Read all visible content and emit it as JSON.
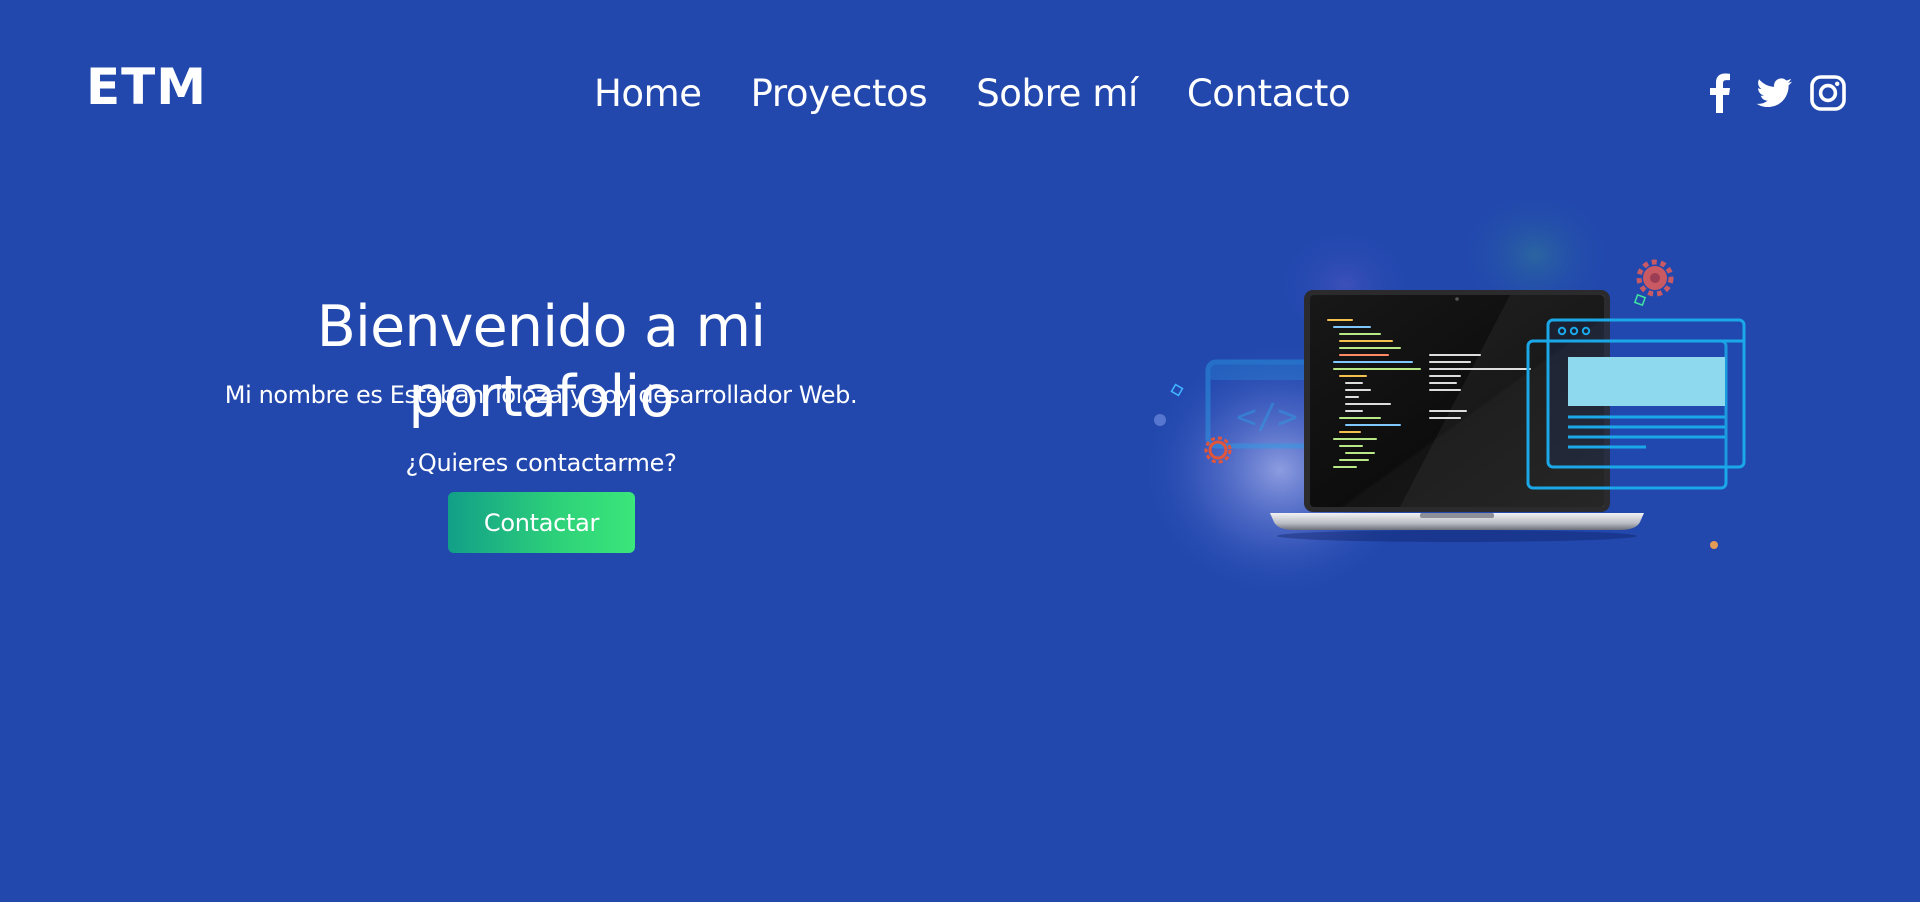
{
  "header": {
    "logo": "ETM",
    "nav": [
      {
        "label": "Home"
      },
      {
        "label": "Proyectos"
      },
      {
        "label": "Sobre mí"
      },
      {
        "label": "Contacto"
      }
    ],
    "social": [
      {
        "icon": "facebook-icon"
      },
      {
        "icon": "twitter-icon"
      },
      {
        "icon": "instagram-icon"
      }
    ]
  },
  "hero": {
    "title": "Bienvenido a mi portafolio",
    "subtitle": "Mi nombre es Esteban Toloza y soy desarrollador Web.",
    "question": "¿Quieres contactarme?",
    "cta_label": "Contactar"
  },
  "illustration": {
    "icon": "laptop-code-illustration"
  },
  "colors": {
    "background": "#2248ae",
    "text": "#ffffff",
    "cta_gradient_start": "#129f88",
    "cta_gradient_end": "#3be67a",
    "window_outline": "#1aa8e8",
    "window_fill": "#8fd9ee",
    "gear": "#e2553a"
  }
}
